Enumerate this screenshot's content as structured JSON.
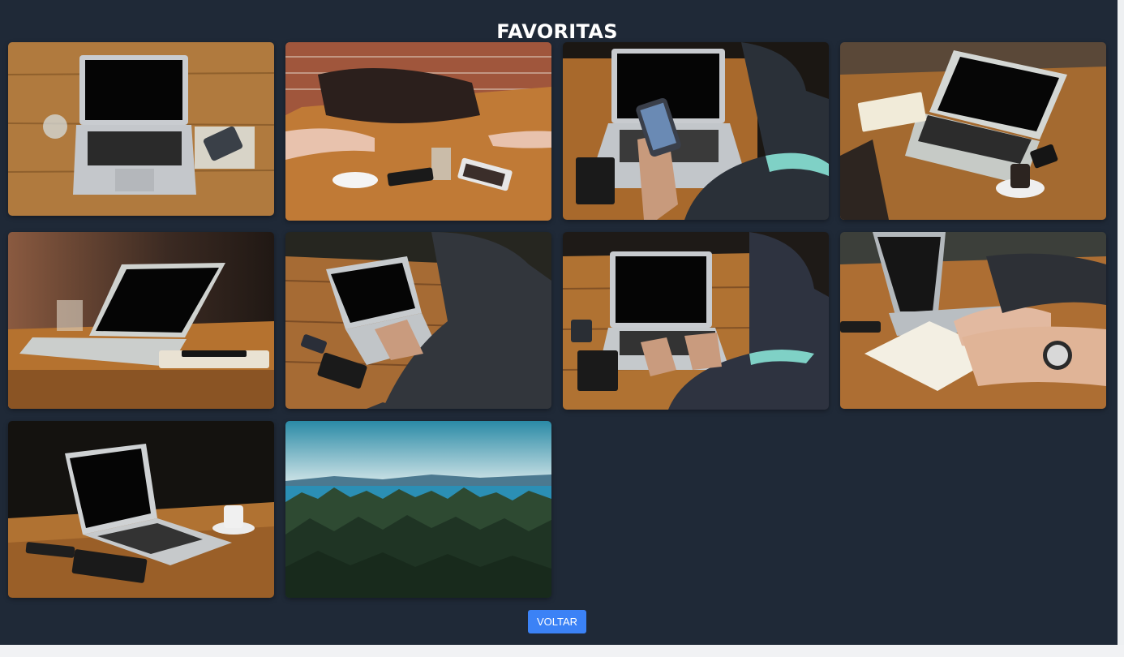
{
  "header": {
    "title": "FAVORITAS"
  },
  "favorites": [
    {
      "subject": "laptop-on-wooden-table-with-phone-and-glass"
    },
    {
      "subject": "meeting-on-wooden-table-with-bag-and-tablet"
    },
    {
      "subject": "man-holding-phone-at-laptop"
    },
    {
      "subject": "laptop-with-notebook-and-coffee"
    },
    {
      "subject": "laptop-on-table-in-warm-light"
    },
    {
      "subject": "man-typing-on-laptop-outdoors"
    },
    {
      "subject": "man-typing-on-laptop-at-wooden-table"
    },
    {
      "subject": "hand-writing-in-notebook-near-laptop"
    },
    {
      "subject": "laptop-with-coffee-on-dark-background"
    },
    {
      "subject": "forest-and-lake-landscape"
    }
  ],
  "actions": {
    "back_label": "VOLTAR"
  },
  "colors": {
    "background": "#1f2937",
    "title": "#ffffff",
    "button": "#3b82f6",
    "button_text": "#ffffff"
  }
}
